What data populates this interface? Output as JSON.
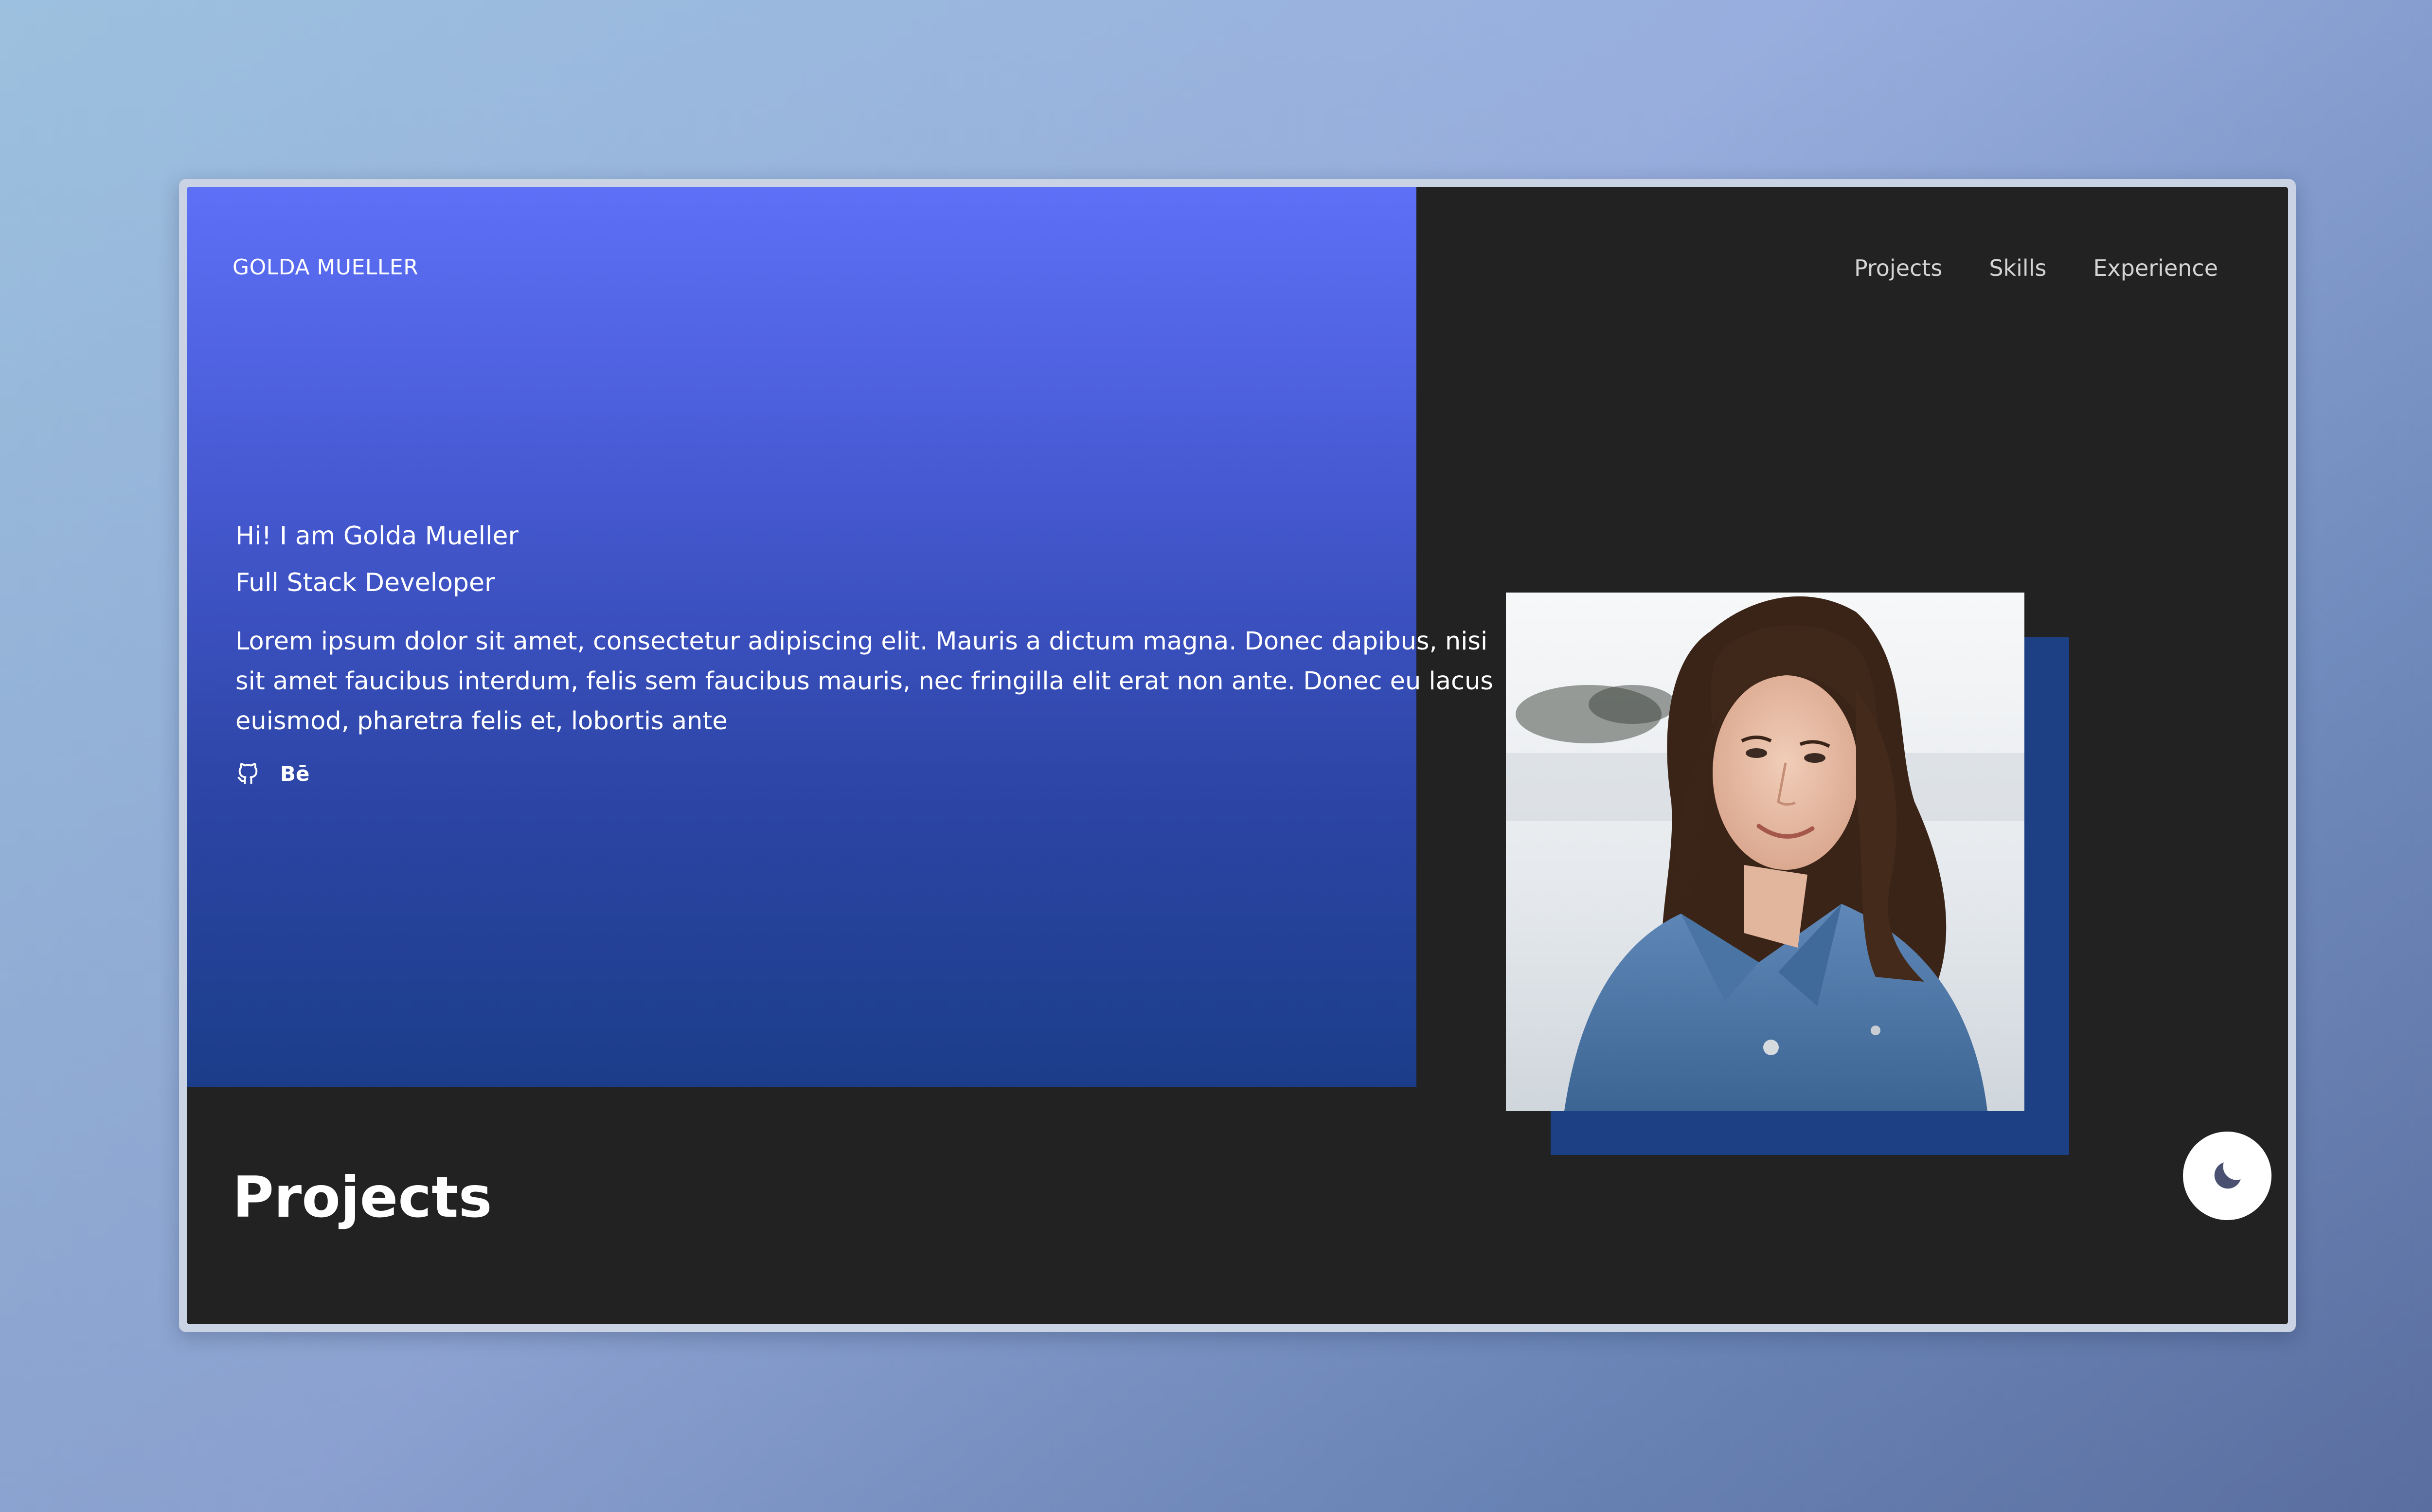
{
  "header": {
    "brand": "GOLDA MUELLER",
    "nav": [
      {
        "label": "Projects"
      },
      {
        "label": "Skills"
      },
      {
        "label": "Experience"
      }
    ]
  },
  "hero": {
    "greeting": "Hi! I am Golda Mueller",
    "role": "Full Stack Developer",
    "bio": "Lorem ipsum dolor sit amet, consectetur adipiscing elit. Mauris a dictum magna. Donec dapibus, nisi sit amet faucibus interdum, felis sem faucibus mauris, nec fringilla elit erat non ante. Donec eu lacus euismod, pharetra felis et, lobortis ante",
    "socials": {
      "github_icon": "github-icon",
      "behance_label": "Bē"
    },
    "photo_icon": "profile-photo"
  },
  "projects": {
    "title": "Projects"
  },
  "theme_toggle": {
    "icon": "moon-icon"
  },
  "colors": {
    "hero_gradient_top": "#5d70f7",
    "hero_gradient_bottom": "#1b3d89",
    "page_background": "#222222",
    "photo_accent": "#1d3f83"
  }
}
